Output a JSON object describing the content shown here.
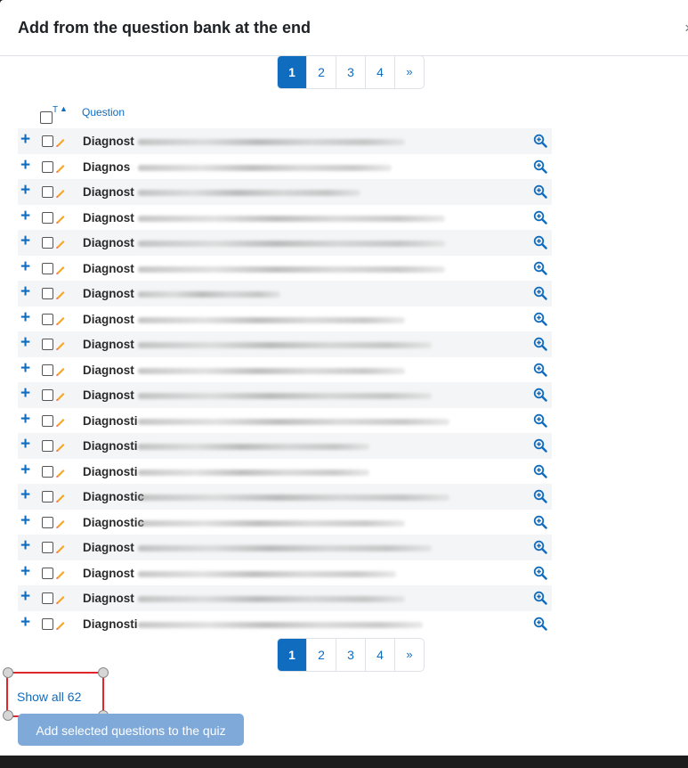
{
  "modal": {
    "title": "Add from the question bank at the end",
    "close_label": "×"
  },
  "pagination": {
    "pages": [
      "1",
      "2",
      "3",
      "4"
    ],
    "next_label": "»",
    "current": "1"
  },
  "table": {
    "sort_type_label": "T",
    "sort_arrow": "▲",
    "question_header": "Question",
    "rows": [
      {
        "name": "Diagnost",
        "tail": "{{@an...}}\\)."
      },
      {
        "name": "Diagnos",
        "tail": "..."
      },
      {
        "name": "Diagnost",
        "tail": "{@..."
      },
      {
        "name": "Diagnost",
        "tail": "aind ... y ..."
      },
      {
        "name": "Diagnost",
        "tail": "exp ..."
      },
      {
        "name": "Diagnost",
        "tail": "n@ ... s ..."
      },
      {
        "name": "Diagnost",
        "tail": "te"
      },
      {
        "name": "Diagnost",
        "tail": "ngle ..."
      },
      {
        "name": "Diagnost",
        "tail": "..."
      },
      {
        "name": "Diagnost",
        "tail": "..."
      },
      {
        "name": "Diagnost",
        "tail": "on ..."
      },
      {
        "name": "Diagnosti",
        "tail": "@}. ..."
      },
      {
        "name": "Diagnosti",
        "tail": ""
      },
      {
        "name": "Diagnosti",
        "tail": "\\)"
      },
      {
        "name": "Diagnostic",
        "tail": "}\\) ..."
      },
      {
        "name": "Diagnostic",
        "tail": "the ..."
      },
      {
        "name": "Diagnost",
        "tail": "d ..."
      },
      {
        "name": "Diagnost",
        "tail": "@s ..."
      },
      {
        "name": "Diagnost",
        "tail": "..."
      },
      {
        "name": "Diagnosti",
        "tail": "If \\({@p... then ..."
      }
    ]
  },
  "footer": {
    "show_all_label": "Show all 62",
    "add_selected_label": "Add selected questions to the quiz"
  },
  "colors": {
    "accent": "#0f6cbf",
    "highlight_box": "#e0262b",
    "disabled_button": "#7fa9d8"
  },
  "icons": {
    "add": "plus-icon",
    "preview": "magnifier-plus-icon",
    "qtype": "pencil-icon",
    "close": "close-icon"
  }
}
